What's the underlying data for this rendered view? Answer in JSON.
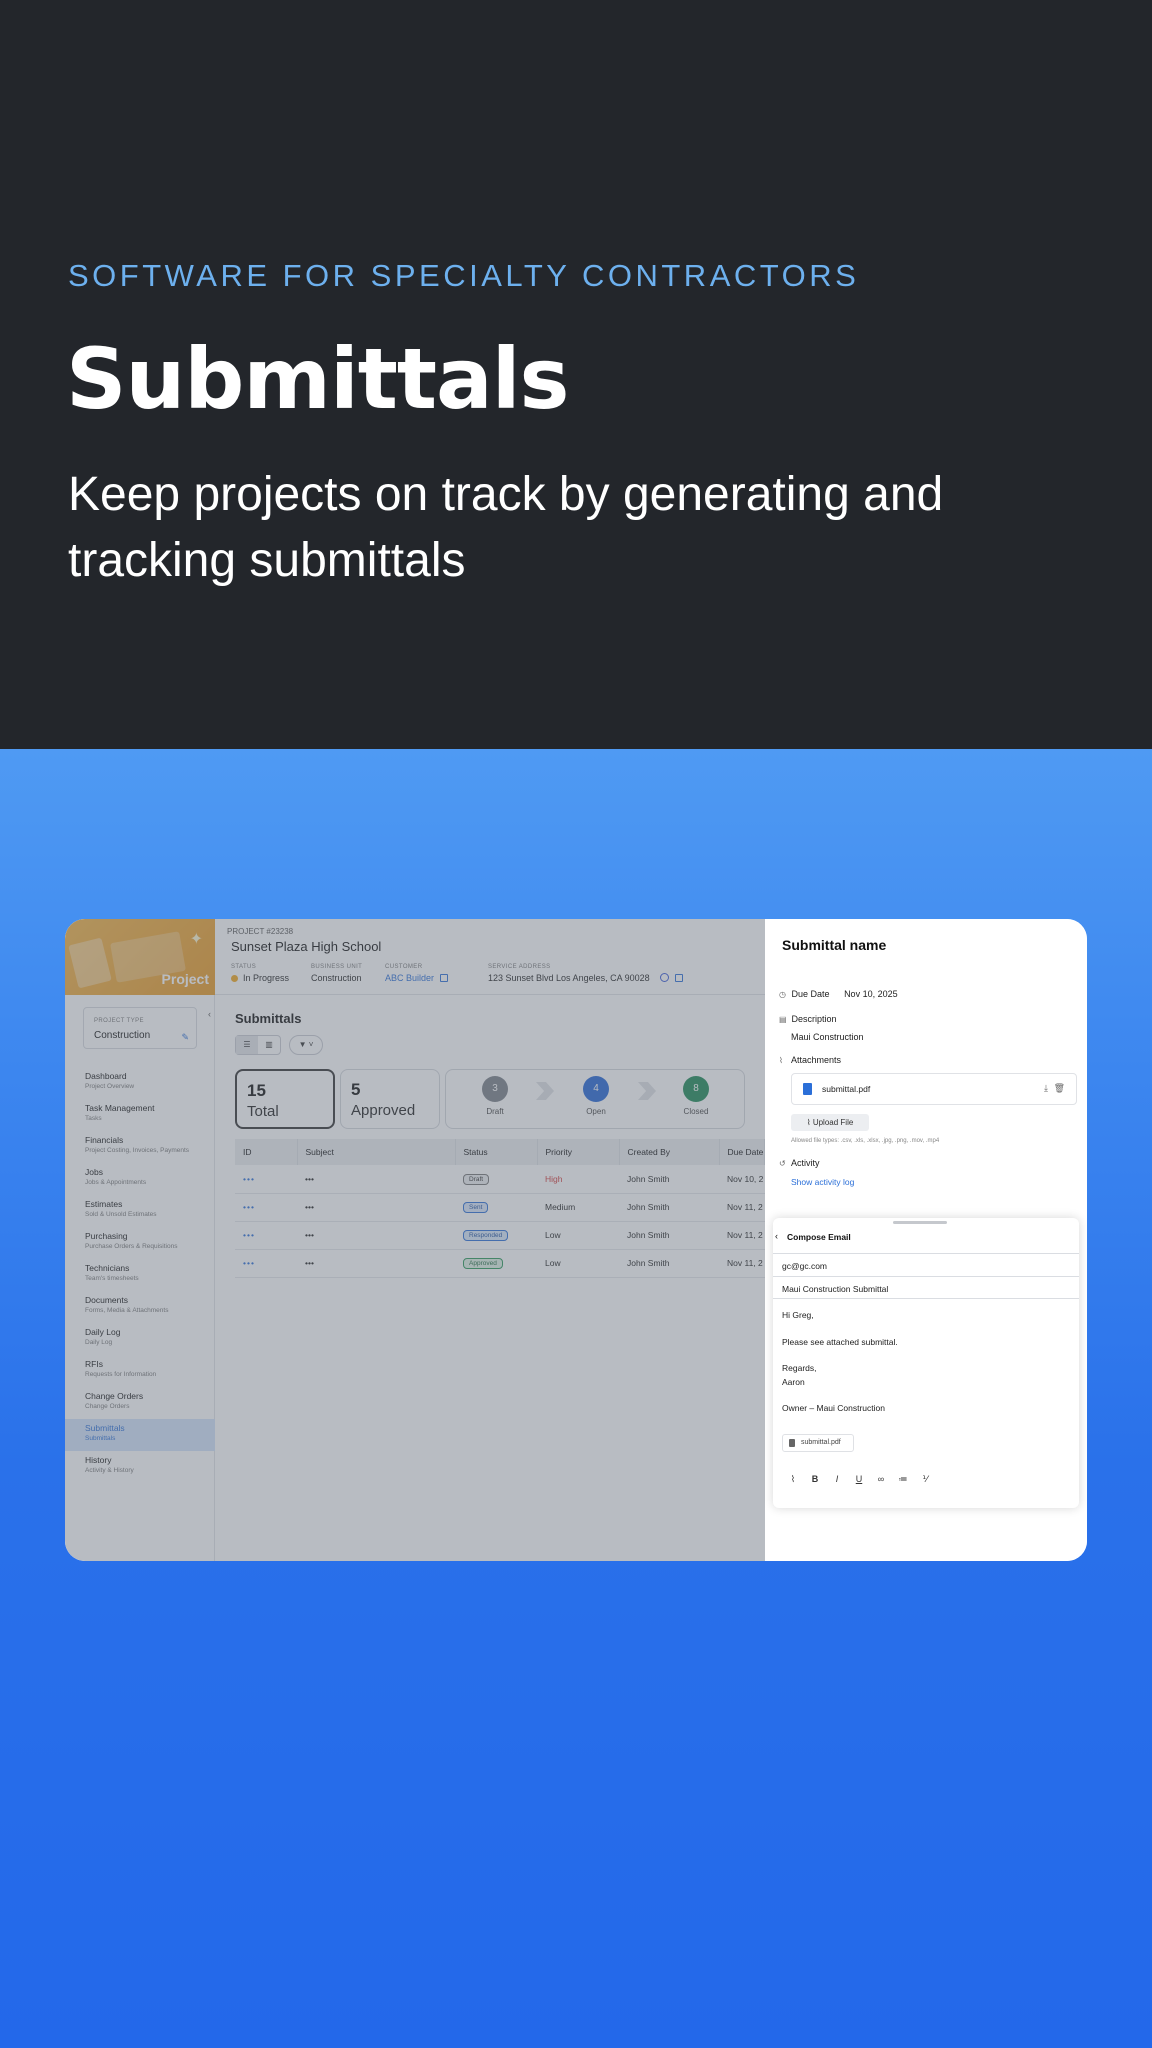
{
  "hero": {
    "eyebrow": "SOFTWARE FOR SPECIALTY CONTRACTORS",
    "headline": "Submittals",
    "subhead": "Keep projects on track by generating and tracking submittals"
  },
  "project": {
    "tile_label": "Project",
    "number": "PROJECT #23238",
    "name": "Sunset Plaza High School",
    "status_label": "STATUS",
    "status_value": "In Progress",
    "status_color": "#f3a81f",
    "bu_label": "BUSINESS UNIT",
    "bu_value": "Construction",
    "customer_label": "CUSTOMER",
    "customer_value": "ABC Builder",
    "address_label": "SERVICE ADDRESS",
    "address_value": "123 Sunset Blvd Los Angeles, CA 90028"
  },
  "sidebar": {
    "type_label": "PROJECT TYPE",
    "type_value": "Construction",
    "items": [
      {
        "title": "Dashboard",
        "sub": "Project Overview"
      },
      {
        "title": "Task Management",
        "sub": "Tasks"
      },
      {
        "title": "Financials",
        "sub": "Project Costing, Invoices, Payments"
      },
      {
        "title": "Jobs",
        "sub": "Jobs & Appointments"
      },
      {
        "title": "Estimates",
        "sub": "Sold & Unsold Estimates"
      },
      {
        "title": "Purchasing",
        "sub": "Purchase Orders & Requisitions"
      },
      {
        "title": "Technicians",
        "sub": "Team's timesheets"
      },
      {
        "title": "Documents",
        "sub": "Forms, Media & Attachments"
      },
      {
        "title": "Daily Log",
        "sub": "Daily Log"
      },
      {
        "title": "RFIs",
        "sub": "Requests for Information"
      },
      {
        "title": "Change Orders",
        "sub": "Change Orders"
      },
      {
        "title": "Submittals",
        "sub": "Submittals"
      },
      {
        "title": "History",
        "sub": "Activity & History"
      }
    ]
  },
  "main": {
    "title": "Submittals",
    "stats": [
      {
        "number": "15",
        "label": "Total"
      },
      {
        "number": "5",
        "label": "Approved"
      }
    ],
    "pipeline": [
      {
        "count": "3",
        "label": "Draft",
        "color": "#7b8088"
      },
      {
        "count": "4",
        "label": "Open",
        "color": "#2466d6"
      },
      {
        "count": "8",
        "label": "Closed",
        "color": "#1d8a55"
      }
    ],
    "columns": [
      "ID",
      "Subject",
      "Status",
      "Priority",
      "Created By",
      "Due Date"
    ],
    "rows": [
      {
        "id": "•••",
        "subject": "•••",
        "status": "Draft",
        "priority": "High",
        "created_by": "John Smith",
        "due": "Nov 10, 2"
      },
      {
        "id": "•••",
        "subject": "•••",
        "status": "Sent",
        "priority": "Medium",
        "created_by": "John Smith",
        "due": "Nov 11, 2"
      },
      {
        "id": "•••",
        "subject": "•••",
        "status": "Responded",
        "priority": "Low",
        "created_by": "John Smith",
        "due": "Nov 11, 2"
      },
      {
        "id": "•••",
        "subject": "•••",
        "status": "Approved",
        "priority": "Low",
        "created_by": "John Smith",
        "due": "Nov 11, 2"
      }
    ]
  },
  "panel": {
    "title": "Submittal name",
    "due_label": "Due Date",
    "due_value": "Nov 10, 2025",
    "desc_label": "Description",
    "desc_value": "Maui Construction",
    "att_label": "Attachments",
    "att_file": "submittal.pdf",
    "upload_label": "Upload File",
    "allowed": "Allowed file types: .csv, .xls, .xlsx, .jpg, .png, .mov, .mp4",
    "activity_label": "Activity",
    "activity_link": "Show activity log"
  },
  "compose": {
    "title": "Compose Email",
    "to": "gc@gc.com",
    "subject": "Maui Construction Submittal",
    "greeting": "Hi Greg,",
    "line1": "Please see attached submittal.",
    "regards": "Regards,",
    "name": "Aaron",
    "signature": "Owner – Maui Construction",
    "attachment": "submittal.pdf"
  }
}
